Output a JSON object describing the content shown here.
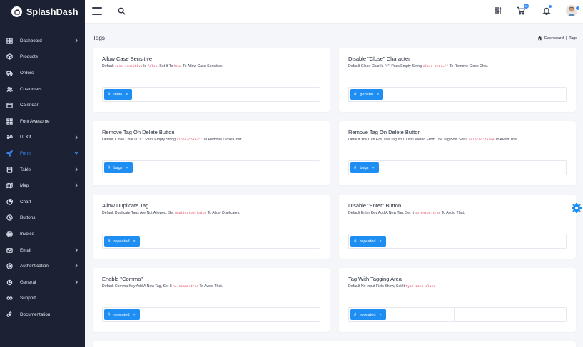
{
  "brand": {
    "name": "SplashDash"
  },
  "header": {
    "cart_badge": "03",
    "bell_badge": "",
    "avatar": "user-avatar"
  },
  "nav": [
    {
      "label": "Dashboard",
      "icon": "dashboard-icon",
      "chevron": true
    },
    {
      "label": "Products",
      "icon": "box-icon",
      "chevron": false
    },
    {
      "label": "Orders",
      "icon": "truck-icon",
      "chevron": false
    },
    {
      "label": "Customers",
      "icon": "users-icon",
      "chevron": false
    },
    {
      "label": "Calendar",
      "icon": "calendar-icon",
      "chevron": false
    },
    {
      "label": "Font Awesome",
      "icon": "grid-icon",
      "chevron": false
    },
    {
      "label": "UI Kit",
      "icon": "ui-kit-icon",
      "chevron": true
    },
    {
      "label": "Form",
      "icon": "send-icon",
      "chevron": true,
      "active": true
    },
    {
      "label": "Table",
      "icon": "table-icon",
      "chevron": true
    },
    {
      "label": "Map",
      "icon": "map-icon",
      "chevron": true
    },
    {
      "label": "Chart",
      "icon": "chart-icon",
      "chevron": false
    },
    {
      "label": "Buttons",
      "icon": "cursor-icon",
      "chevron": false
    },
    {
      "label": "Invoice",
      "icon": "printer-icon",
      "chevron": false
    },
    {
      "label": "Email",
      "icon": "mail-icon",
      "chevron": true
    },
    {
      "label": "Authentication",
      "icon": "lock-icon",
      "chevron": true
    },
    {
      "label": "General",
      "icon": "settings-icon",
      "chevron": true
    },
    {
      "label": "Support",
      "icon": "headset-icon",
      "chevron": false
    },
    {
      "label": "Documentation",
      "icon": "paperclip-icon",
      "chevron": false
    }
  ],
  "page": {
    "title": "Tags",
    "breadcrumb": {
      "home": "Dashboard",
      "separator": "|",
      "current": "Tags"
    }
  },
  "cards": [
    {
      "title": "Allow Case Sensitive",
      "desc_parts": [
        "Default ",
        "{code}",
        " Is ",
        "{code}",
        ". Set It To ",
        "{code}",
        " To Allow Case Sensitive."
      ],
      "codes": [
        "case-sensitive",
        "false",
        "true"
      ],
      "tag": "india"
    },
    {
      "title": "Disable \"Close\" Character",
      "desc_parts": [
        "Default Close Char Is \"×\". Pass Empty String ",
        "{code}",
        " To Remove Close Char."
      ],
      "codes": [
        "close-char=\"\""
      ],
      "tag": "general"
    },
    {
      "title": "Remove Tag On Delete Button",
      "desc_parts": [
        "Default Close Char Is \"×\". Pass Empty String ",
        "{code}",
        " To Remove Close Char."
      ],
      "codes": [
        "close-char=\"\""
      ],
      "tag": "bags"
    },
    {
      "title": "Remove Tag On Delete Button",
      "desc_parts": [
        "Default You Can Edit The Tag You Just Deleted From The Tag Box. Set It ",
        "{code}",
        " To Avoid That."
      ],
      "codes": [
        "deleted:false"
      ],
      "tag": "bags"
    },
    {
      "title": "Allow Duplicate Tag",
      "desc_parts": [
        "Default Duplicate Tags Are Not Allowed, Set ",
        "{code}",
        " To Allow Duplicates."
      ],
      "codes": [
        "duplicated:false"
      ],
      "tag": "repeated"
    },
    {
      "title": "Disable \"Enter\" Button",
      "desc_parts": [
        "Default Enter Key Add A New Tag, Set It ",
        "{code}",
        " To Avoid That."
      ],
      "codes": [
        "no-enter:true"
      ],
      "tag": "repeated"
    },
    {
      "title": "Enable \"Comma\"",
      "desc_parts": [
        "Default Comma Key Add A New Tag, Set It ",
        "{code}",
        " To Avoid That."
      ],
      "codes": [
        "no-comma:true"
      ],
      "tag": "repeated"
    },
    {
      "title": "Tag With Tagging Area",
      "desc_parts": [
        "Default No Input Fiels Show, Set It ",
        "{code}",
        ""
      ],
      "codes": [
        "type-zone-class"
      ],
      "tag": "repeated",
      "tagging_area": true
    }
  ],
  "colors": {
    "sidebar": "#1c2134",
    "accent": "#1e8ef3",
    "code": "#e0455e"
  }
}
